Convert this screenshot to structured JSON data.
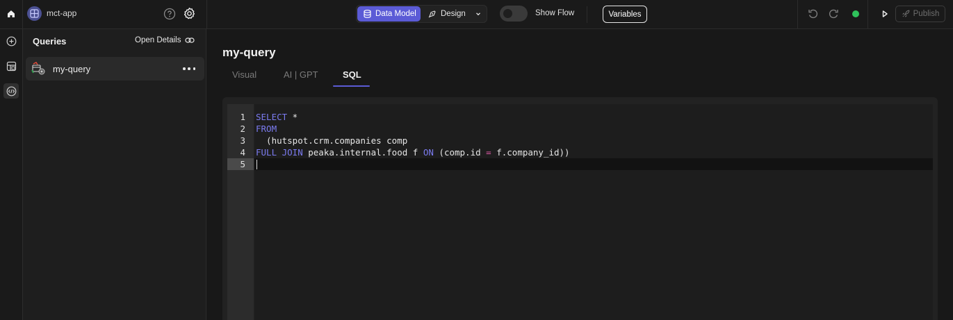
{
  "header": {
    "app_name": "mct-app",
    "mode_tabs": [
      {
        "label": "Data Model",
        "active": true
      },
      {
        "label": "Design",
        "active": false
      }
    ],
    "show_flow_label": "Show Flow",
    "show_flow_enabled": false,
    "variables_label": "Variables",
    "publish_label": "Publish",
    "status_color": "#2fc25b",
    "accent_color": "#5b5bd6"
  },
  "sidebar": {
    "title": "Queries",
    "open_details_label": "Open Details",
    "items": [
      {
        "label": "my-query",
        "icon": "query-table-icon"
      }
    ]
  },
  "main": {
    "title": "my-query",
    "tabs": [
      {
        "label": "Visual",
        "active": false
      },
      {
        "label": "AI | GPT",
        "active": false
      },
      {
        "label": "SQL",
        "active": true
      }
    ],
    "editor": {
      "active_line": 5,
      "line_numbers": [
        "1",
        "2",
        "3",
        "4",
        "5"
      ],
      "lines": [
        [
          {
            "t": "SELECT",
            "c": "kw"
          },
          {
            "t": " *",
            "c": ""
          }
        ],
        [
          {
            "t": "FROM",
            "c": "kw"
          }
        ],
        [
          {
            "t": "  (hutspot.crm.companies comp",
            "c": ""
          }
        ],
        [
          {
            "t": "FULL JOIN",
            "c": "kw"
          },
          {
            "t": " peaka.internal.food f ",
            "c": ""
          },
          {
            "t": "ON",
            "c": "kw"
          },
          {
            "t": " (comp.id ",
            "c": ""
          },
          {
            "t": "=",
            "c": "op"
          },
          {
            "t": " f.company_id))",
            "c": ""
          }
        ],
        []
      ]
    }
  }
}
